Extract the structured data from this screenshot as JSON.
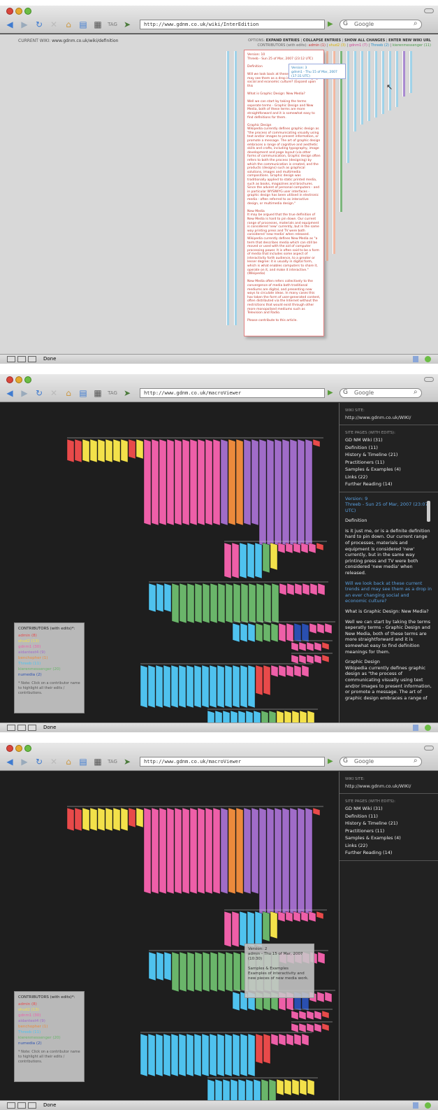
{
  "browser": {
    "url_wiki": "http://www.gdnm.co.uk/wiki/InterEdition",
    "url_viewer": "http://www.gdnm.co.uk/macroViewer",
    "search_placeholder": "Google",
    "status_text": "Done"
  },
  "window1": {
    "current_wiki_label": "CURRENT WIKI:",
    "current_wiki": "www.gdnm.co.uk/wiki/definition",
    "options_label": "OPTIONS:",
    "options": [
      "EXPAND ENTRIES",
      "COLLAPSE ENTRIES",
      "SHOW ALL CHANGES",
      "ENTER NEW WIKI URL"
    ],
    "contributors_label": "CONTRIBUTORS (with edits):",
    "contributors": [
      "admin (1)",
      "shud2 (3)",
      "gdnm1 (7)",
      "Threeb (2)",
      "kierenmessenger (11)"
    ],
    "tooltip": {
      "version": "Version: 3",
      "meta": "gdnm1 - Thu 15 of Mar, 2007 (17:31 UTC)"
    },
    "doc": {
      "version": "Version: 10",
      "meta": "Threeb - Sun 25 of Mar, 2007 (23:12 UTC)",
      "heading": "Definition",
      "intro": "Will we look back at these current trends and may see them as a drop in an ever changing social and economic culture? (Expand upon this",
      "question": "What is Graphic Design: New Media?",
      "para1": "Well we can start by taking the terms seperate terms - Graphic Design and New Media, both of these terms are more straightforward and it is somewhat easy to find definitions for them.",
      "gd_title": "Graphic Design",
      "gd_text": "Wikipedia currently defines graphic design as \"the process of communicating visually using text and/or images to present information, or promote a message. The art of graphic design embraces a range of cognitive and aesthetic skills and crafts, including typography, image development and page layout (via other forms of communication, Graphic design often refers to both the process (designing) by which the communication is created, and the products (designs) such as graphical solutions, images and multimedia compositions. Graphic design was traditionally applied to static printed media, such as books, magazines and brochures. Since the advent of personal computers - and in particular WYSIWYG user interfaces - graphic design has been utilised in electronic media - often referred to as interactive design, or multimedia design.\"",
      "nm_title": "New Media",
      "nm_text": "It may be argued that the true definition of New Media is hard to pin down. Our current range of processes, materials and equipment is considered 'new' currently, but in the same way printing press and TV were both considered 'new media' when released. Wikipedia currently defines New Media as \"a term that describes media which can still be moved or used with the aid of computer processing power. It is often said to be a form of media that includes some aspect of interactivity forth audience, to a greater or lesser degree: it is usually in digital form, which is what enables computers to share it, operate on it, and make it interactive.\" (Wikipedia)",
      "nm_text2": "New Media often refers collectively to the convergence of media both traditional mediums are digital, and presenting new ways to circulate ideas. In many cases this has taken the form of user-generated content, often distributed via the Internet without the restrictions that would exist through other more monopolised mediums such as Television and Radio.",
      "closing": "Please contribute to this article."
    }
  },
  "viewer": {
    "wiki_site_label": "WIKI SITE:",
    "wiki_site": "http://www.gdnm.co.uk/WIKI/",
    "pages_label": "SITE PAGES (WITH EDITS):",
    "pages": [
      "GD NM Wiki (31)",
      "Definition (11)",
      "History & Timeline (21)",
      "Practitioners (11)",
      "Samples & Examples (4)",
      "Links (22)",
      "Further Reading (14)"
    ],
    "legend_title": "CONTRIBUTORS (with edits)*:",
    "legend": [
      {
        "name": "admin (8)",
        "color": "#e84a4a"
      },
      {
        "name": "shud2 (13)",
        "color": "#f3e14a"
      },
      {
        "name": "gdnm1 (30)",
        "color": "#ee5fa8"
      },
      {
        "name": "aidantest4 (9)",
        "color": "#a06cc8"
      },
      {
        "name": "benchopher (1)",
        "color": "#ec8a3c"
      },
      {
        "name": "Threeb (11)",
        "color": "#4fc2ee"
      },
      {
        "name": "kierenmessenger (20)",
        "color": "#6ab56a"
      },
      {
        "name": "numedia (2)",
        "color": "#2a4fb0"
      }
    ],
    "legend_note": "* Note: Click on a contributor name to highlight all their edits / contributions.",
    "entry": {
      "version": "Version: 9",
      "meta": "Threeb - Sun 25 of Mar, 2007 (23:07 UTC)",
      "heading": "Definition",
      "p1": "Is it just me, or is a definite definition hard to pin down. Our current range of processes, materials and equipment is considered 'new' currently, but in the same way printing press and TV were both considered 'new media' when released.",
      "p2": "Will we look back at these current trends and may see them as a drop in an ever changing social and economic culture?",
      "p3": "What is Graphic Design: New Media?",
      "p4": "Well we can start by taking the terms seperatly terms - Graphic Design and New Media, both of these terms are more straightforward and it is somewhat easy to find definition meanings for them.",
      "p5": "Graphic Design",
      "p6": "Wikipedia currently defines graphic design as \"the process of communicating visually using text and/or images to present information, or promote a message. The art of graphic design embraces a range of"
    },
    "tooltip": {
      "version": "Version: 2",
      "meta": "admin - Thu 15 of Mar, 2007",
      "time": "(10:30)",
      "title": "Samples & Examples",
      "text": "Examples of interactivity and new pieces of new media work."
    }
  }
}
